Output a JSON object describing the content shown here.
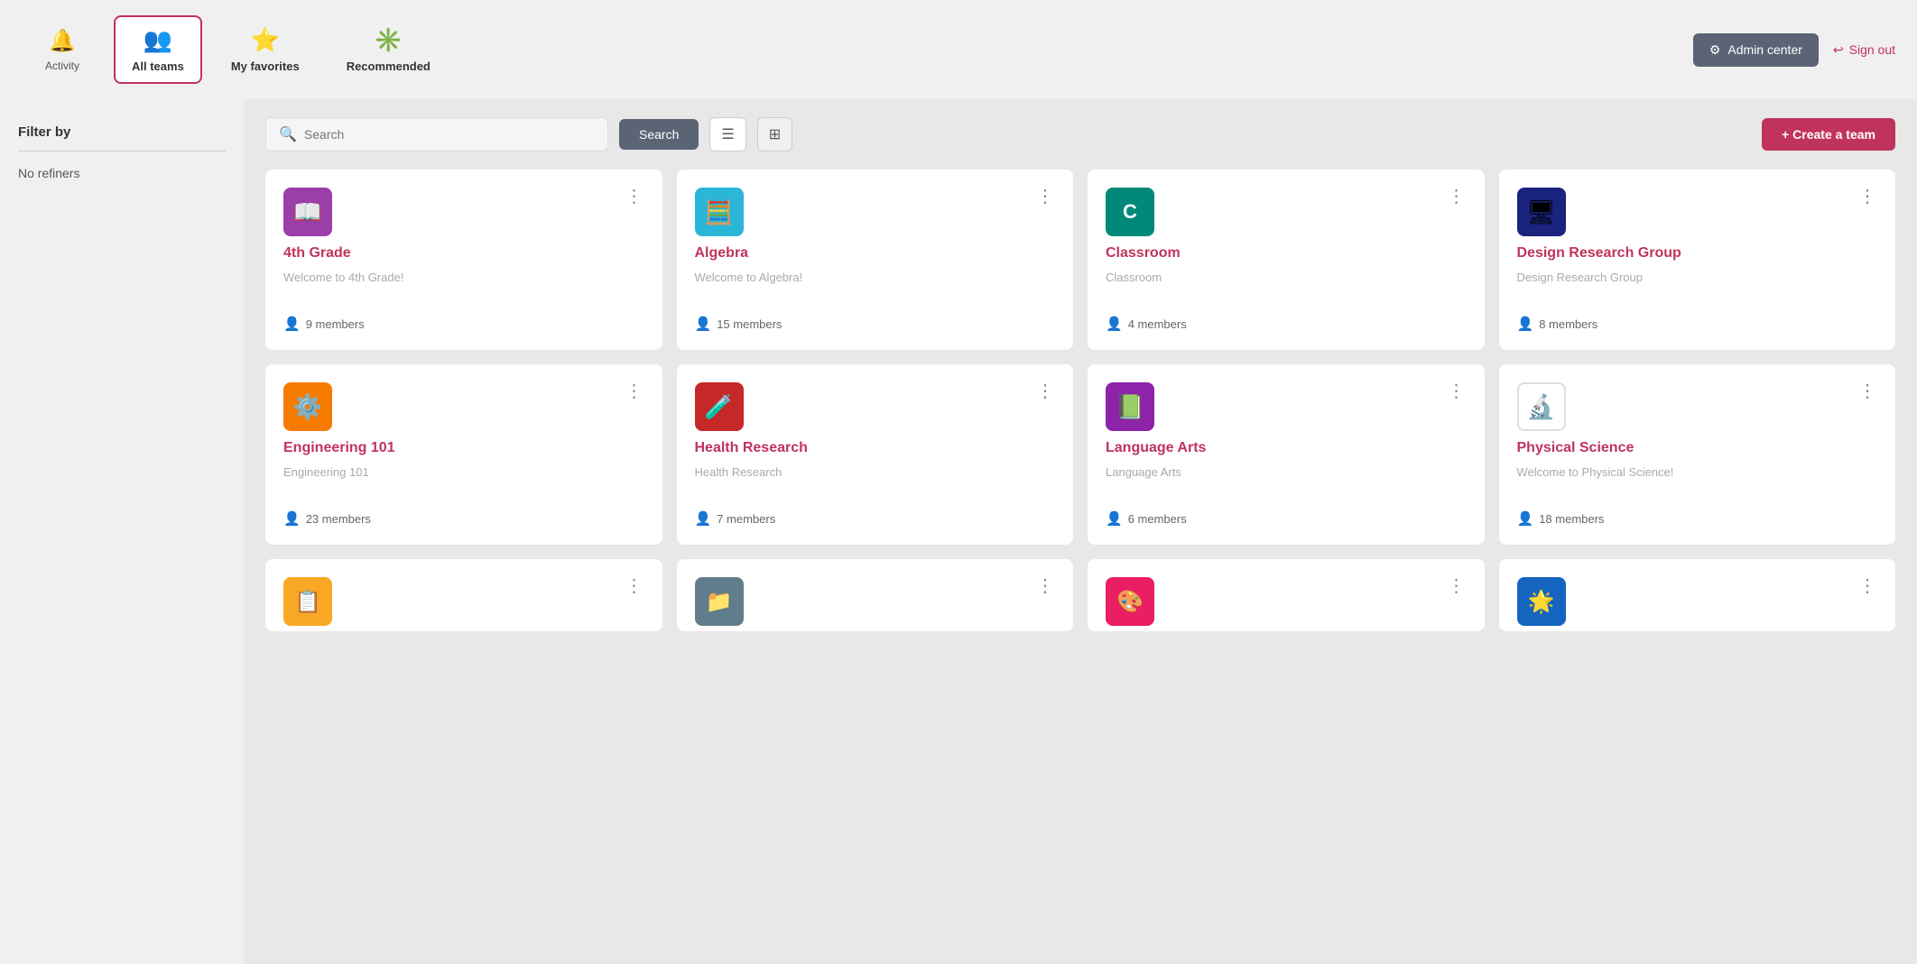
{
  "nav": {
    "activity_label": "Activity",
    "all_teams_label": "All teams",
    "my_favorites_label": "My favorites",
    "recommended_label": "Recommended",
    "admin_center_label": "Admin center",
    "sign_out_label": "Sign out"
  },
  "sidebar": {
    "filter_title": "Filter by",
    "no_refiners": "No refiners"
  },
  "toolbar": {
    "search_placeholder": "Search",
    "search_button": "Search",
    "create_button": "+ Create a team"
  },
  "teams": [
    {
      "id": "4th-grade",
      "name": "4th Grade",
      "description": "Welcome to 4th Grade!",
      "members": "9 members",
      "icon_bg": "#9b3ea8",
      "icon_type": "emoji",
      "icon_emoji": "📖"
    },
    {
      "id": "algebra",
      "name": "Algebra",
      "description": "Welcome to Algebra!",
      "members": "15 members",
      "icon_bg": "#29b6d8",
      "icon_type": "emoji",
      "icon_emoji": "🧮"
    },
    {
      "id": "classroom",
      "name": "Classroom",
      "description": "Classroom",
      "members": "4 members",
      "icon_bg": "#00897b",
      "icon_type": "letter",
      "icon_letter": "C"
    },
    {
      "id": "design-research-group",
      "name": "Design Research Group",
      "description": "Design Research Group",
      "members": "8 members",
      "icon_bg": "#1a237e",
      "icon_type": "emoji",
      "icon_emoji": "🖥"
    },
    {
      "id": "engineering-101",
      "name": "Engineering 101",
      "description": "Engineering 101",
      "members": "23 members",
      "icon_bg": "#f57c00",
      "icon_type": "emoji",
      "icon_emoji": "⚙️"
    },
    {
      "id": "health-research",
      "name": "Health Research",
      "description": "Health Research",
      "members": "7 members",
      "icon_bg": "#c62828",
      "icon_type": "emoji",
      "icon_emoji": "🧪"
    },
    {
      "id": "language-arts",
      "name": "Language Arts",
      "description": "Language Arts",
      "members": "6 members",
      "icon_bg": "#8e24aa",
      "icon_type": "emoji",
      "icon_emoji": "📗"
    },
    {
      "id": "physical-science",
      "name": "Physical Science",
      "description": "Welcome to Physical Science!",
      "members": "18 members",
      "icon_bg": "#ffffff",
      "icon_type": "emoji",
      "icon_emoji": "🔬"
    }
  ],
  "bottom_cards": [
    {
      "icon_bg": "#f9a825",
      "icon_emoji": "📋"
    },
    {
      "icon_bg": "#607d8b",
      "icon_emoji": "📁"
    },
    {
      "icon_bg": "#e91e63",
      "icon_emoji": "🎨"
    },
    {
      "icon_bg": "#1565c0",
      "icon_emoji": "🌟"
    }
  ]
}
